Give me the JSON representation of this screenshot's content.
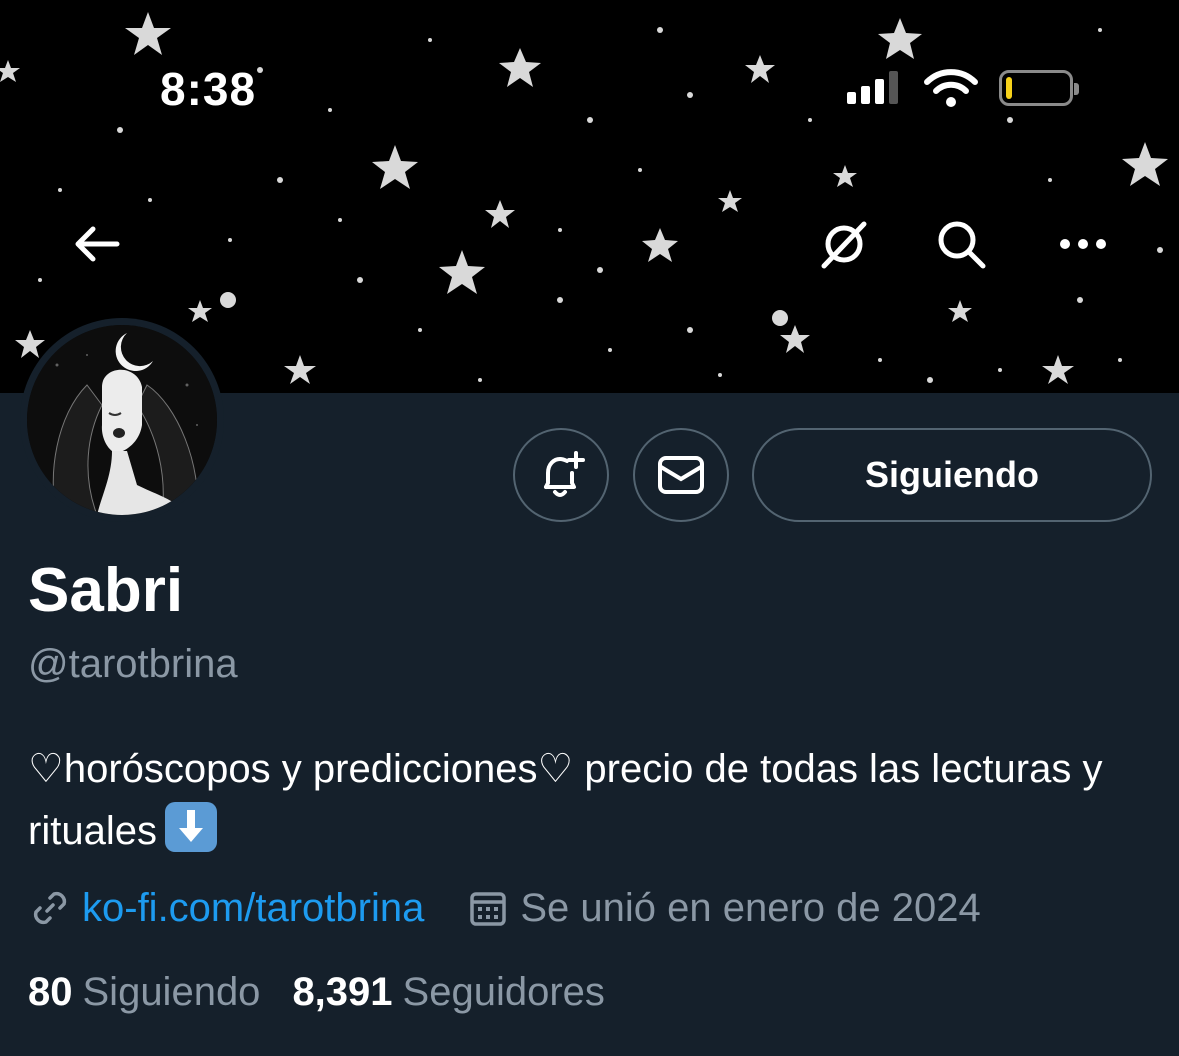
{
  "status_bar": {
    "time": "8:38",
    "battery_level": 0.1
  },
  "nav": {
    "back": "back-arrow-icon",
    "grok": "grok-icon",
    "search": "search-icon",
    "more": "more-dots-icon"
  },
  "profile": {
    "display_name": "Sabri",
    "handle": "@tarotbrina",
    "bio_text": "♡horóscopos y predicciones♡ precio de todas las lecturas y rituales",
    "bio_emoji": "arrow-down-emoji",
    "link": "ko-fi.com/tarotbrina",
    "joined": "Se unió en enero de 2024"
  },
  "actions": {
    "following_label": "Siguiendo"
  },
  "stats": {
    "following_count": "80",
    "following_label": "Siguiendo",
    "followers_count": "8,391",
    "followers_label": "Seguidores"
  },
  "colors": {
    "background": "#15202b",
    "link": "#1d9bf0",
    "secondary_text": "#8b98a5",
    "border": "#536471"
  }
}
